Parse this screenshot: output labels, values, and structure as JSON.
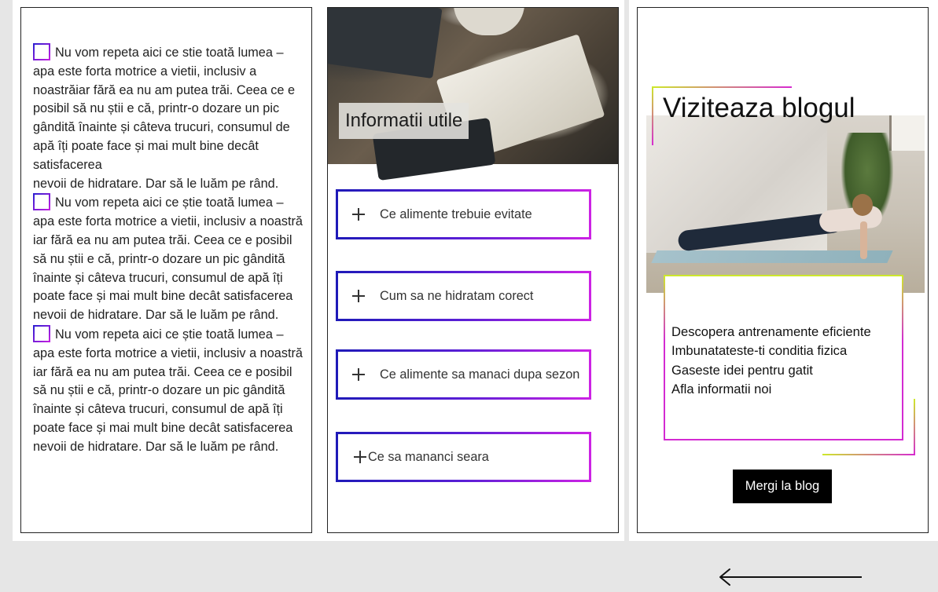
{
  "left_panel": {
    "paragraphs": [
      {
        "text": "Nu vom repeta aici ce stie toată lumea – apa este forta motrice a vietii, inclusiv a noastrăiar fără ea nu am putea trăi. Ceea ce e posibil să nu știi e că, printr-o dozare un pic gândită înainte și câteva trucuri, consumul de apă îți poate face și mai mult bine decât satisfacerea",
        "continuation": "nevoii de hidratare. Dar să le luăm pe rând."
      },
      {
        "text": "Nu vom repeta aici ce știe toată lumea – apa este forta motrice a vietii, inclusiv a noastră iar fără ea nu am putea trăi. Ceea ce e posibil să nu știi e că, printr-o dozare un pic gândită  înainte și câteva trucuri, consumul de apă îți poate face și mai mult bine decât satisfacerea nevoii de hidratare. Dar să le luăm pe rând."
      },
      {
        "text": "Nu vom repeta aici ce știe toată lumea – apa este forta motrice a vietii, inclusiv a noastră iar fără ea nu am putea trăi. Ceea ce e posibil să nu știi e că, printr-o dozare un pic gândită  înainte și câteva trucuri, consumul de apă îți poate face și mai mult bine decât satisfacerea  nevoii de hidratare. Dar să le luăm pe rând."
      }
    ]
  },
  "info_panel": {
    "title": "Informatii utile",
    "accordion": [
      "Ce alimente trebuie evitate",
      "Cum sa ne hidratam corect",
      "Ce alimente sa manaci dupa sezon",
      "Ce sa mananci seara"
    ]
  },
  "blog_panel": {
    "title": "Viziteaza blogul",
    "list": [
      "Descopera antrenamente eficiente",
      "Imbunatateste-ti conditia fizica",
      "Gaseste idei pentru gatit",
      "Afla informatii noi"
    ],
    "button_label": "Mergi la blog"
  },
  "colors": {
    "accordion_gradient_start": "#1f1ab8",
    "accordion_gradient_end": "#cc22e4",
    "frame_lime": "#cde92a",
    "frame_magenta": "#d62ad0"
  },
  "icons": [
    "checkbox-icon",
    "plus-icon",
    "back-arrow-icon"
  ]
}
